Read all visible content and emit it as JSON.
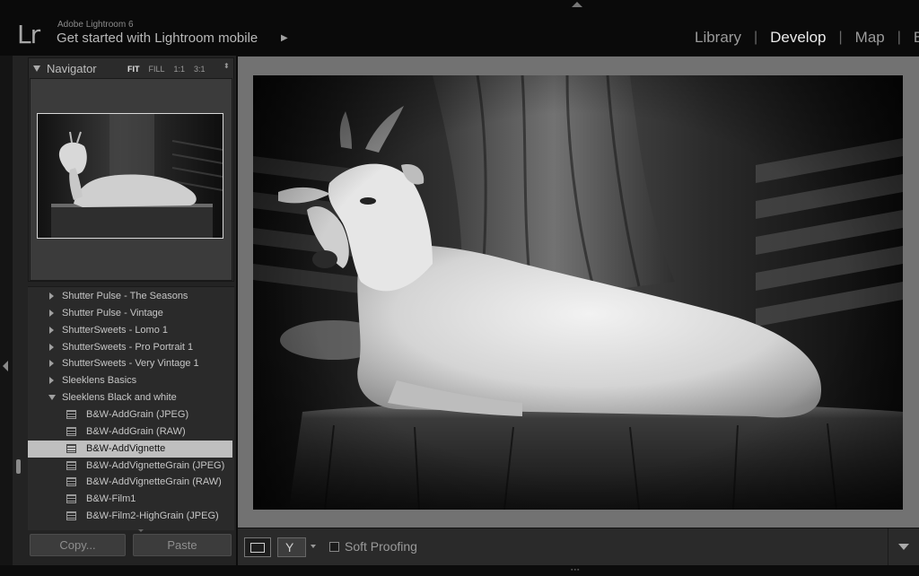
{
  "app": {
    "logo": "Lr",
    "version": "Adobe Lightroom 6",
    "mobile_prompt": "Get started with Lightroom mobile",
    "mobile_arrow": "▶"
  },
  "modules": [
    {
      "label": "Library",
      "active": false
    },
    {
      "label": "Develop",
      "active": true
    },
    {
      "label": "Map",
      "active": false
    },
    {
      "label": "Bo",
      "active": false
    }
  ],
  "navigator": {
    "title": "Navigator",
    "zoom_options": [
      "FIT",
      "FILL",
      "1:1",
      "3:1"
    ],
    "zoom_selected": "FIT",
    "zoom_arrows": "⬍"
  },
  "presets": {
    "items": [
      {
        "type": "folder",
        "label": "Shutter Pulse - The Seasons",
        "expanded": false
      },
      {
        "type": "folder",
        "label": "Shutter Pulse - Vintage",
        "expanded": false
      },
      {
        "type": "folder",
        "label": "ShutterSweets - Lomo 1",
        "expanded": false
      },
      {
        "type": "folder",
        "label": "ShutterSweets - Pro Portrait 1",
        "expanded": false
      },
      {
        "type": "folder",
        "label": "ShutterSweets - Very Vintage 1",
        "expanded": false
      },
      {
        "type": "folder",
        "label": "Sleeklens Basics",
        "expanded": false
      },
      {
        "type": "folder",
        "label": "Sleeklens Black and white",
        "expanded": true
      },
      {
        "type": "preset",
        "label": "B&W-AddGrain (JPEG)",
        "selected": false
      },
      {
        "type": "preset",
        "label": "B&W-AddGrain (RAW)",
        "selected": false
      },
      {
        "type": "preset",
        "label": "B&W-AddVignette",
        "selected": true
      },
      {
        "type": "preset",
        "label": "B&W-AddVignetteGrain (JPEG)",
        "selected": false
      },
      {
        "type": "preset",
        "label": "B&W-AddVignetteGrain (RAW)",
        "selected": false
      },
      {
        "type": "preset",
        "label": "B&W-Film1",
        "selected": false
      },
      {
        "type": "preset",
        "label": "B&W-Film2-HighGrain (JPEG)",
        "selected": false
      }
    ]
  },
  "buttons": {
    "copy": "Copy...",
    "paste": "Paste"
  },
  "toolbar": {
    "soft_proofing_label": "Soft Proofing",
    "soft_proofing_checked": false,
    "before_after_glyph": "Y"
  },
  "colors": {
    "panel_bg": "#232323",
    "canvas_bg": "#727272",
    "selected_row": "#bfbfbf",
    "active_module": "#eaeaea"
  }
}
